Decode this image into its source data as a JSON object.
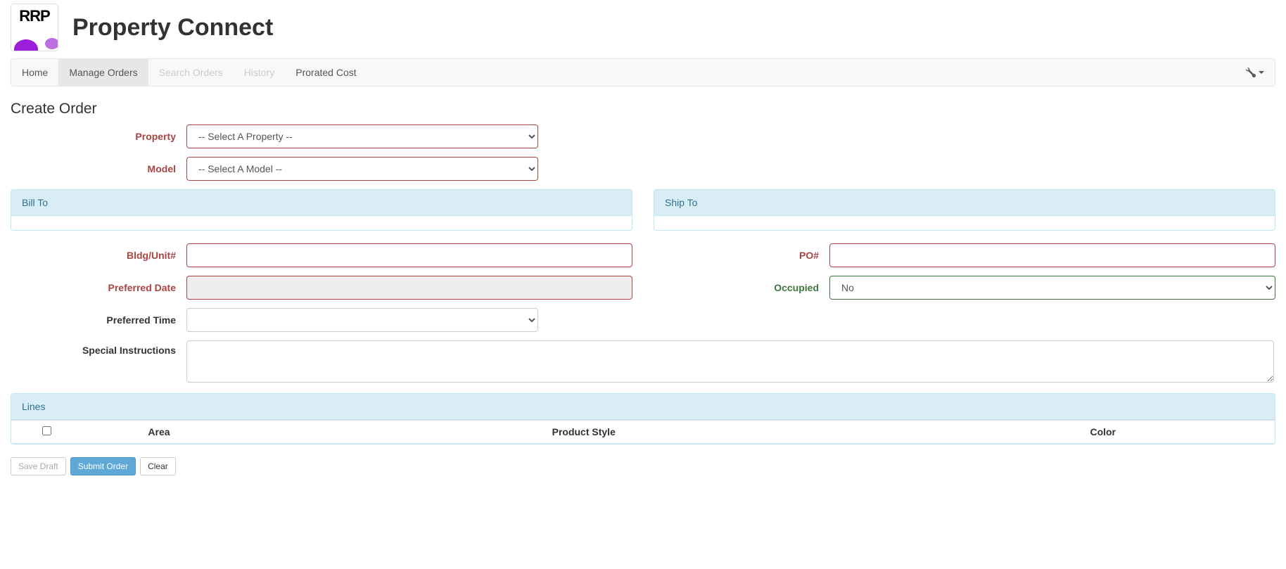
{
  "header": {
    "logo_text": "RRP",
    "title": "Property Connect"
  },
  "nav": {
    "home": "Home",
    "manage_orders": "Manage Orders",
    "search_orders": "Search Orders",
    "history": "History",
    "prorated_cost": "Prorated Cost"
  },
  "page": {
    "title": "Create Order"
  },
  "form": {
    "property_label": "Property",
    "property_placeholder": "-- Select A Property --",
    "model_label": "Model",
    "model_placeholder": "-- Select A Model --",
    "bill_to_label": "Bill To",
    "ship_to_label": "Ship To",
    "bldg_unit_label": "Bldg/Unit#",
    "po_label": "PO#",
    "preferred_date_label": "Preferred Date",
    "occupied_label": "Occupied",
    "occupied_value": "No",
    "preferred_time_label": "Preferred Time",
    "special_instructions_label": "Special Instructions"
  },
  "lines": {
    "title": "Lines",
    "columns": {
      "area": "Area",
      "product_style": "Product Style",
      "color": "Color"
    }
  },
  "buttons": {
    "save_draft": "Save Draft",
    "submit_order": "Submit Order",
    "clear": "Clear"
  }
}
